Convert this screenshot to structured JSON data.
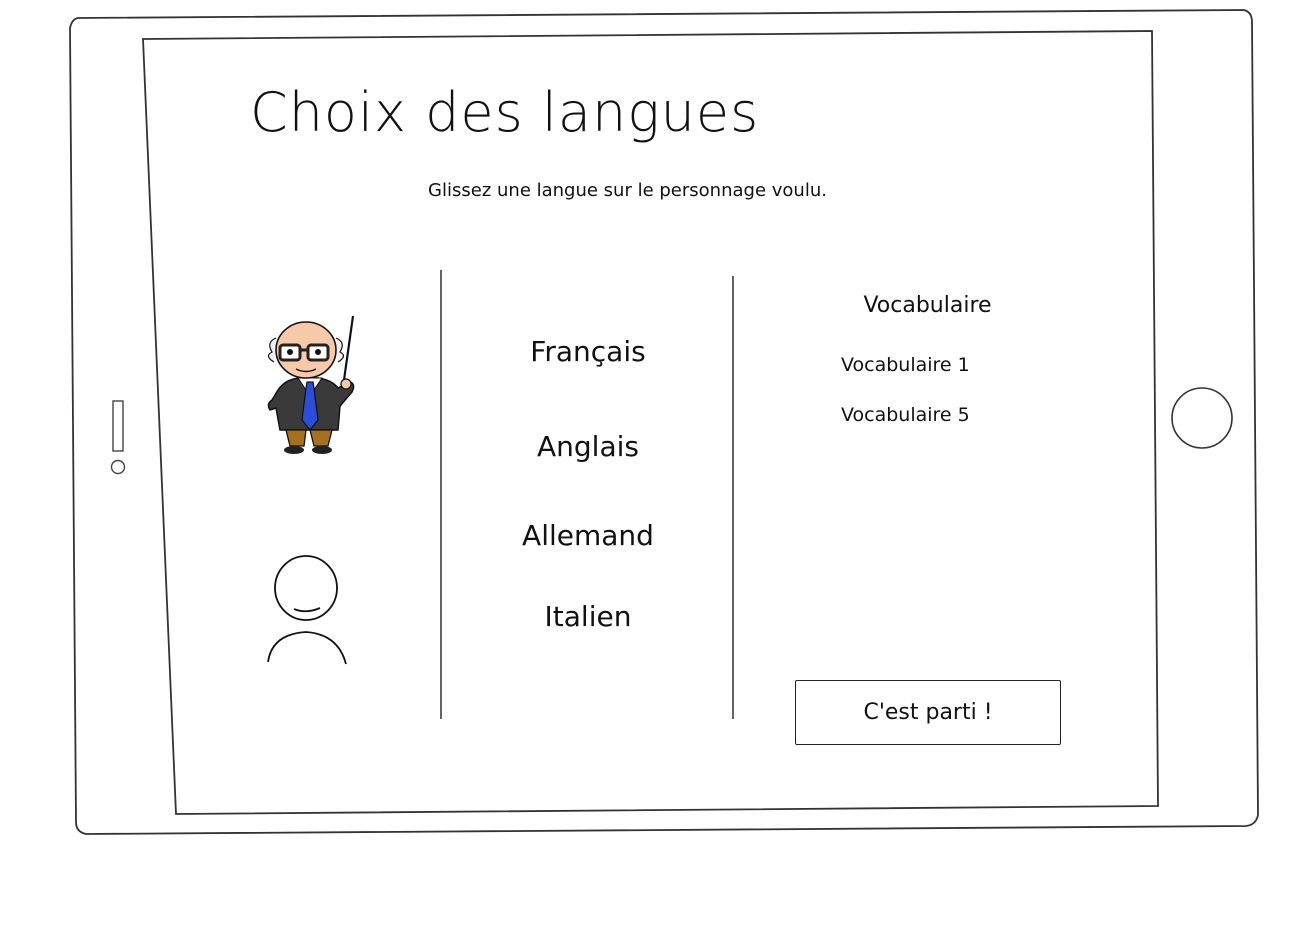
{
  "screen": {
    "title": "Choix des langues",
    "subtitle": "Glissez une langue sur le personnage voulu."
  },
  "characters": [
    {
      "name": "teacher",
      "icon": "teacher-character-icon"
    },
    {
      "name": "student",
      "icon": "person-placeholder-icon"
    }
  ],
  "languages": [
    {
      "label": "Français"
    },
    {
      "label": "Anglais"
    },
    {
      "label": "Allemand"
    },
    {
      "label": "Italien"
    }
  ],
  "vocabulary": {
    "header": "Vocabulaire",
    "items": [
      {
        "label": "Vocabulaire 1"
      },
      {
        "label": "Vocabulaire 5"
      }
    ]
  },
  "actions": {
    "start_label": "C'est parti !"
  },
  "colors": {
    "stroke": "#222222",
    "tie": "#2a4ed8",
    "jacket": "#3a3a3a",
    "trousers": "#a8701c",
    "skin": "#f6c9a8"
  }
}
